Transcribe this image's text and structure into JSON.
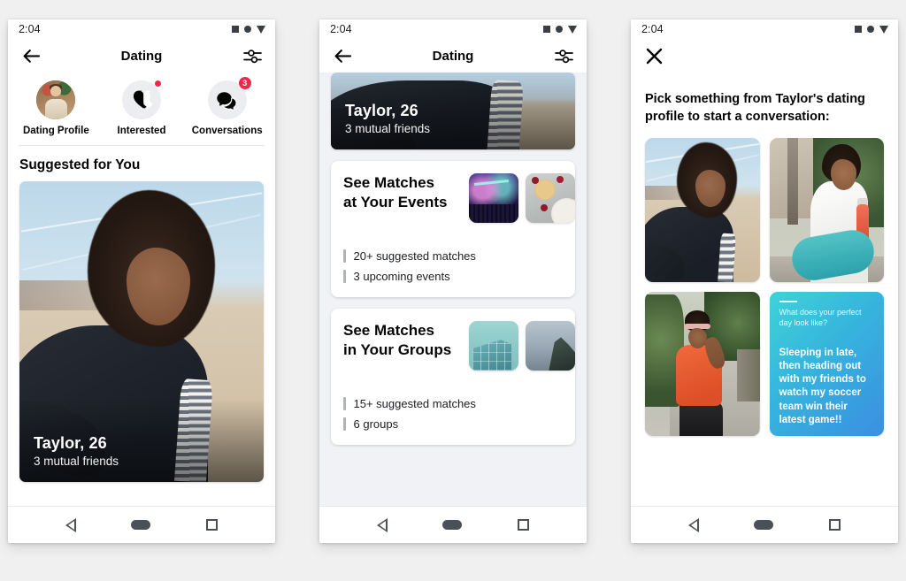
{
  "screens": [
    {
      "id": "dating-home",
      "statusbar": {
        "time": "2:04",
        "icons": [
          "square-icon",
          "circle-icon",
          "triangle-down-icon"
        ]
      },
      "appbar": {
        "back_icon": "back-arrow-icon",
        "title": "Dating",
        "settings_icon": "sliders-settings-icon"
      },
      "shortcuts": [
        {
          "label": "Dating Profile",
          "icon": "profile-avatar",
          "badge": ""
        },
        {
          "label": "Interested",
          "icon": "double-heart-icon",
          "badge": "dot"
        },
        {
          "label": "Conversations",
          "icon": "chat-bubbles-icon",
          "badge": "3"
        }
      ],
      "section_title": "Suggested for You",
      "profile_card": {
        "name": "Taylor, 26",
        "mutual": "3 mutual friends",
        "photo": "beach-selfie-photo"
      }
    },
    {
      "id": "dating-matches",
      "statusbar": {
        "time": "2:04",
        "icons": [
          "square-icon",
          "circle-icon",
          "triangle-down-icon"
        ]
      },
      "appbar": {
        "back_icon": "back-arrow-icon",
        "title": "Dating",
        "settings_icon": "sliders-settings-icon"
      },
      "banner": {
        "name": "Taylor, 26",
        "mutual": "3 mutual friends",
        "photo": "beach-selfie-photo"
      },
      "cards": [
        {
          "title_line1": "See Matches",
          "title_line2": "at Your Events",
          "thumbs": [
            "concert-aurora-thumbnail",
            "food-plate-thumbnail"
          ],
          "stats": [
            "20+ suggested matches",
            "3 upcoming events"
          ]
        },
        {
          "title_line1": "See Matches",
          "title_line2": "in Your Groups",
          "thumbs": [
            "glass-building-thumbnail",
            "coastal-cliff-thumbnail"
          ],
          "stats": [
            "15+ suggested matches",
            "6 groups"
          ]
        }
      ]
    },
    {
      "id": "conversation-starter",
      "statusbar": {
        "time": "2:04",
        "icons": [
          "square-icon",
          "circle-icon",
          "triangle-down-icon"
        ]
      },
      "appbar": {
        "close_icon": "close-x-icon"
      },
      "prompt": "Pick something from Taylor's dating profile to start a conversation:",
      "tiles": [
        {
          "type": "photo",
          "photo": "beach-selfie-photo"
        },
        {
          "type": "photo",
          "photo": "yoga-mat-photo"
        },
        {
          "type": "photo",
          "photo": "sidewalk-walk-photo"
        },
        {
          "type": "qa",
          "question": "What does your perfect day look like?",
          "answer": "Sleeping in late, then heading out with my friends to watch my soccer team win their latest game!!",
          "gradient_from": "#3fd2d8",
          "gradient_to": "#3a8fe0"
        }
      ]
    }
  ],
  "navbar": {
    "back": "android-back-icon",
    "home": "android-home-icon",
    "recents": "android-recents-icon"
  },
  "colors": {
    "page_background": "#f0f0f0",
    "phone_background": "#ffffff",
    "feed_background": "#f0f2f5",
    "badge_red": "#f02849",
    "text_primary": "#050505",
    "nav_gray": "#4a5057"
  }
}
